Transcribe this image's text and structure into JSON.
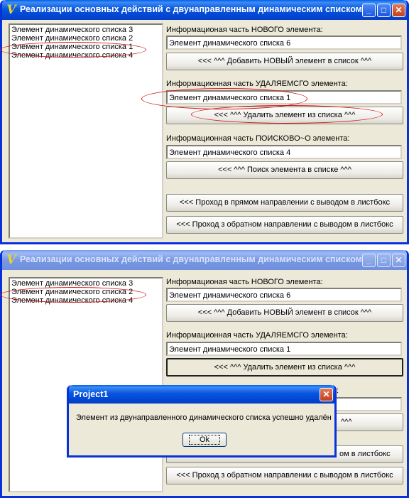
{
  "top_window": {
    "title": "Реализации основных действий с двунаправленным динамическим списком",
    "listbox_items": [
      "Элемент динамического списка 3",
      "Элемент динамического списка 2",
      "Элемент динамического списка 1",
      "Элемент динамического списка 4"
    ],
    "new_label": "Информационая часть НОВОГО элемента:",
    "new_value": "Элемент динамического списка 6",
    "add_button": "<<< ^^^ Добавить НОВЫЙ элемент в список ^^^",
    "delete_label": "Информационная часть УДАЛЯЕМСГО элемента:",
    "delete_value": "Элемент динамического списка 1",
    "delete_button": "<<< ^^^ Удалить элемент из списка ^^^",
    "search_label": "Информационная часть ПОИСКОВО~О элемента:",
    "search_value": "Элемент динамического списка 4",
    "search_button": "<<< ^^^ Поиск элемента в списке ^^^",
    "forward_button": "<<< Проход в прямом направлении с выводом в листбокс",
    "backward_button": "<<< Проход з обратном направлении с выводом в листбокс"
  },
  "bottom_window": {
    "title": "Реализации основных действий с двунаправленным динамическим списком",
    "listbox_items": [
      "Элемент динамического списка 3",
      "Элемент динамического списка 2",
      "Элемент динамического списка 4"
    ],
    "new_label": "Информационая часть НОВОГО элемента:",
    "new_value": "Элемент динамического списка 6",
    "add_button": "<<< ^^^ Добавить НОВЫЙ элемент в список ^^^",
    "delete_label": "Информационная часть УДАЛЯЕМСГО элемента:",
    "delete_value": "Элемент динамического списка 1",
    "delete_button": "<<< ^^^ Удалить элемент из списка ^^^",
    "search_label_fragment": ":",
    "search_button_fragment": "^^^",
    "forward_button_fragment": "ом в листбокс",
    "backward_button": "<<< Проход з обратном направлении с выводом в листбокс"
  },
  "dialog": {
    "title": "Project1",
    "message": "Элемент из двунаправленного динамического списка успешно удалён",
    "ok_label": "Ok"
  },
  "window_buttons": {
    "minimize": "_",
    "maximize": "□",
    "close": "✕"
  },
  "icons": {
    "app": "app-logo-icon",
    "minimize": "minimize-icon",
    "maximize": "maximize-icon",
    "close": "close-icon"
  },
  "colors": {
    "title_active": "#0a55de",
    "title_inactive": "#7a98e3",
    "window_face": "#ece9d8",
    "annotation": "#d01818"
  }
}
